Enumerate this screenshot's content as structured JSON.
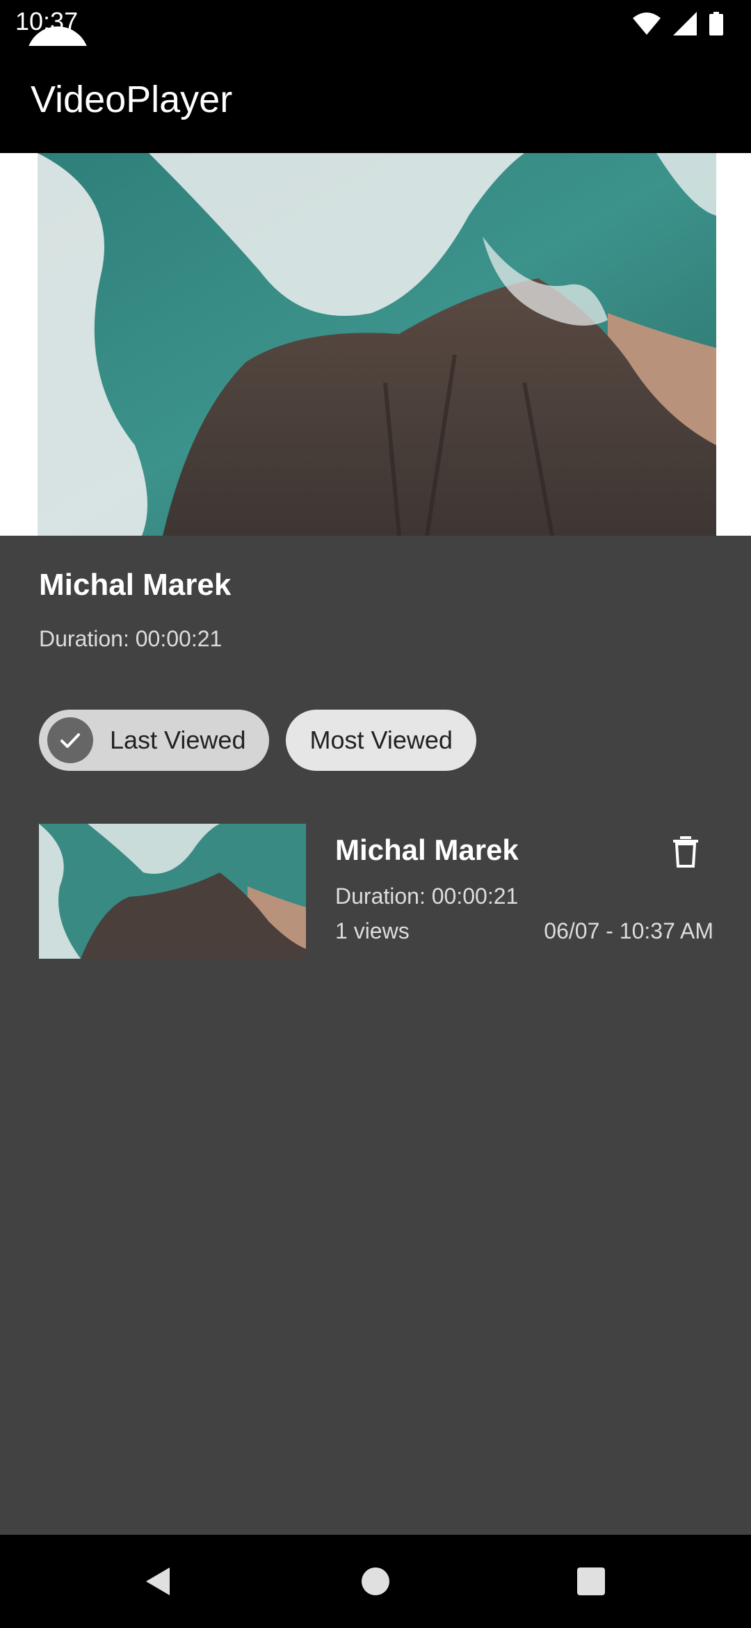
{
  "status_bar": {
    "time": "10:37",
    "icons": [
      "wifi-icon",
      "cellular-signal-icon",
      "battery-icon"
    ]
  },
  "app_bar": {
    "title": "VideoPlayer"
  },
  "now_playing": {
    "title": "Michal Marek",
    "duration": "Duration: 00:00:21"
  },
  "filters": [
    {
      "label": "Last Viewed",
      "selected": true
    },
    {
      "label": "Most Viewed",
      "selected": false
    }
  ],
  "videos": [
    {
      "title": "Michal Marek",
      "duration": "Duration: 00:00:21",
      "views": "1 views",
      "date": "06/07 - 10:37 AM",
      "action_icon": "delete-icon"
    }
  ],
  "nav": [
    "back-icon",
    "home-icon",
    "recents-icon"
  ],
  "colors": {
    "panel_bg": "#424242",
    "chip_selected": "#d5d5d5",
    "chip_unselected": "#e6e6e6"
  }
}
